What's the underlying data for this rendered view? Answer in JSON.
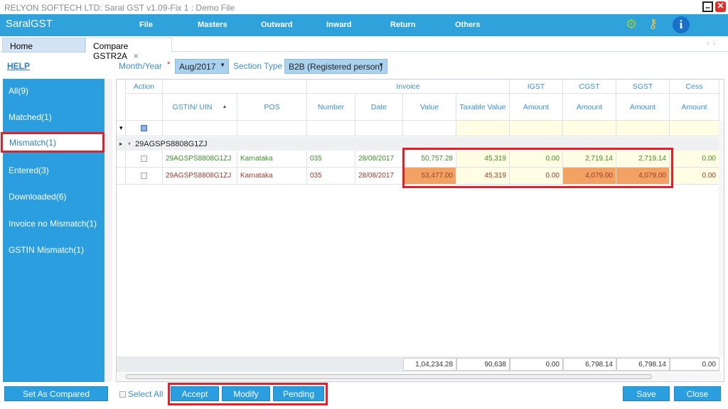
{
  "window": {
    "title": "RELYON SOFTECH LTD: Saral GST v1.09-Fix 1 : Demo File"
  },
  "brand": {
    "logo": "SaralGST"
  },
  "menu": [
    "File",
    "Masters",
    "Outward",
    "Inward",
    "Return",
    "Others"
  ],
  "toolbar_icons": [
    "settings-gear-icon",
    "key-icon",
    "info-icon"
  ],
  "tabs": [
    {
      "label": "Home"
    },
    {
      "label": "Compare GSTR2A"
    }
  ],
  "filters": {
    "help": "HELP",
    "month_label": "Month/Year",
    "required": "*",
    "month_value": "Aug/2017",
    "section_label": "Section Type",
    "section_value": "B2B (Registered person)"
  },
  "sidebar": {
    "items": [
      "All(9)",
      "Matched(1)",
      "Mismatch(1)",
      "Entered(3)",
      "Downloaded(6)",
      "Invoice no Mismatch(1)",
      "GSTIN Mismatch(1)"
    ],
    "selected": "Mismatch(1)"
  },
  "grid": {
    "group_headers": {
      "action": "Action",
      "invoice": "Invoice",
      "igst": "IGST",
      "cgst": "CGST",
      "sgst": "SGST",
      "cess": "Cess"
    },
    "columns": [
      "GSTIN/ UIN",
      "POS",
      "Number",
      "Date",
      "Value",
      "Taxable Value",
      "Amount",
      "Amount",
      "Amount",
      "Amount"
    ],
    "group": "29AGSPS8808G1ZJ",
    "rows": [
      [
        "29AGSPS8808G1ZJ",
        "Karnataka",
        "035",
        "28/08/2017",
        "50,757.28",
        "45,319",
        "0.00",
        "2,719.14",
        "2,719.14",
        "0.00"
      ],
      [
        "29AGSPS8808G1ZJ",
        "Karnataka",
        "035",
        "28/08/2017",
        "53,477.00",
        "45,319",
        "0.00",
        "4,079.00",
        "4,079.00",
        "0.00"
      ]
    ],
    "totals": [
      "1,04,234.28",
      "90,638",
      "0.00",
      "6,798.14",
      "6,798.14",
      "0.00"
    ]
  },
  "footer": {
    "set_as_compared": "Set As Compared",
    "select_all": "Select All",
    "accept": "Accept",
    "modify": "Modify",
    "pending": "Pending",
    "save": "Save",
    "close": "Close"
  },
  "colors": {
    "accent": "#2b9ee0",
    "mismatch": "#f3a264",
    "highlight": "#e0202b"
  }
}
